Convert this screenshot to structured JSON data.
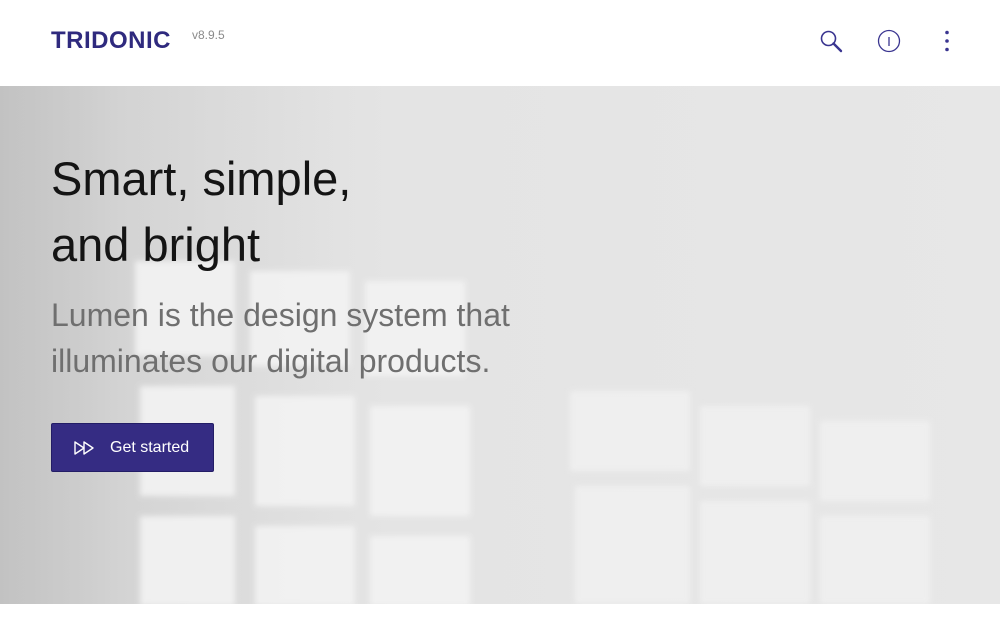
{
  "header": {
    "logo_text": "TRIDONIC",
    "version": "v8.9.5",
    "icons": [
      "search-icon",
      "info-icon",
      "more-vertical-icon"
    ]
  },
  "hero": {
    "title_line1": "Smart, simple,",
    "title_line2": "and bright",
    "subtitle_line1": "Lumen is the design system that",
    "subtitle_line2": "illuminates our digital products.",
    "cta_label": "Get started",
    "cta_icon": "fast-forward-icon"
  },
  "colors": {
    "brand": "#2f2a7e",
    "cta_background": "#352c83",
    "icon": "#3a3590"
  }
}
